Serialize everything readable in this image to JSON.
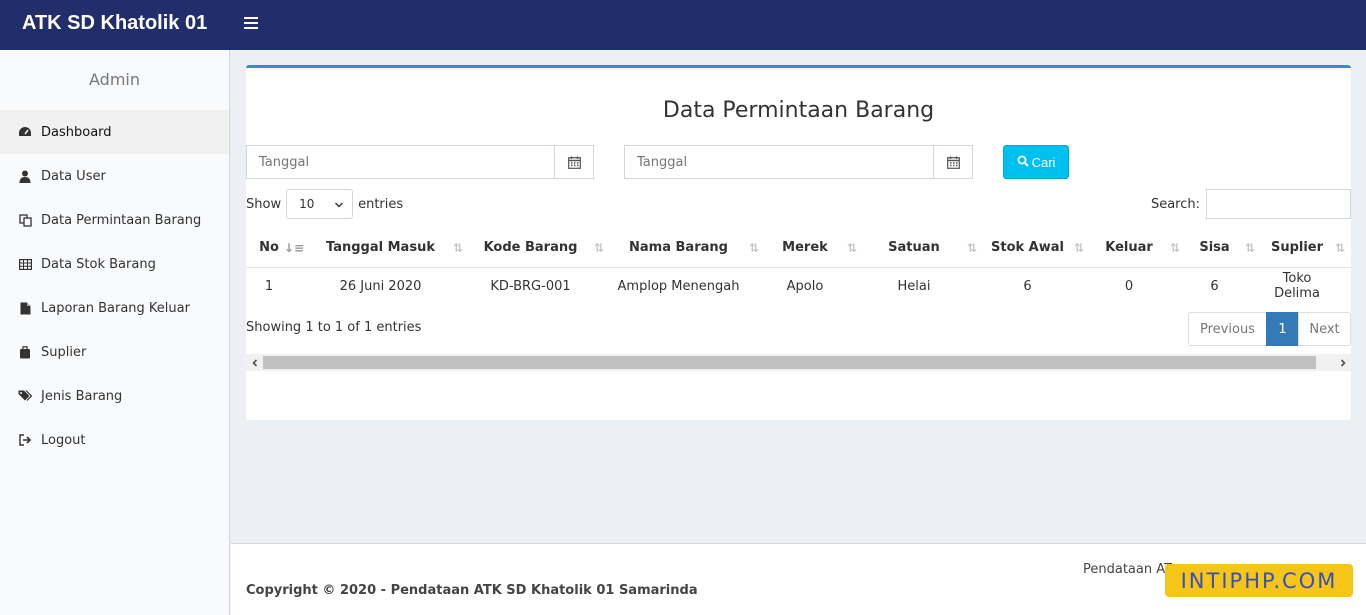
{
  "header": {
    "brand": "ATK SD Khatolik 01"
  },
  "sidebar": {
    "user": "Admin",
    "items": [
      {
        "label": "Dashboard",
        "icon": "dashboard-icon"
      },
      {
        "label": "Data User",
        "icon": "user-icon"
      },
      {
        "label": "Data Permintaan Barang",
        "icon": "copy-icon"
      },
      {
        "label": "Data Stok Barang",
        "icon": "table-icon"
      },
      {
        "label": "Laporan Barang Keluar",
        "icon": "file-icon"
      },
      {
        "label": "Suplier",
        "icon": "suitcase-icon"
      },
      {
        "label": "Jenis Barang",
        "icon": "tags-icon"
      },
      {
        "label": "Logout",
        "icon": "sign-out-icon"
      }
    ]
  },
  "main": {
    "title": "Data Permintaan Barang",
    "date_from_placeholder": "Tanggal",
    "date_to_placeholder": "Tanggal",
    "search_button": "Cari",
    "show_label": "Show",
    "entries_label": "entries",
    "page_length": "10",
    "search_label": "Search:",
    "columns": [
      "No",
      "Tanggal Masuk",
      "Kode Barang",
      "Nama Barang",
      "Merek",
      "Satuan",
      "Stok Awal",
      "Keluar",
      "Sisa",
      "Suplier"
    ],
    "rows": [
      [
        "1",
        "26 Juni 2020",
        "KD-BRG-001",
        "Amplop Menengah",
        "Apolo",
        "Helai",
        "6",
        "0",
        "6",
        "Toko Delima"
      ]
    ],
    "info": "Showing 1 to 1 of 1 entries",
    "pagination": {
      "previous": "Previous",
      "current": "1",
      "next": "Next"
    }
  },
  "footer": {
    "copyright": "Copyright © 2020 - Pendataan ATK SD Khatolik 01 Samarinda",
    "right_text": "Pendataan AT"
  },
  "watermark": "INTIPHP.COM",
  "colors": {
    "header": "#222d6b",
    "accent": "#3c8dbc",
    "button": "#00c0ef",
    "page_active": "#337ab7"
  }
}
